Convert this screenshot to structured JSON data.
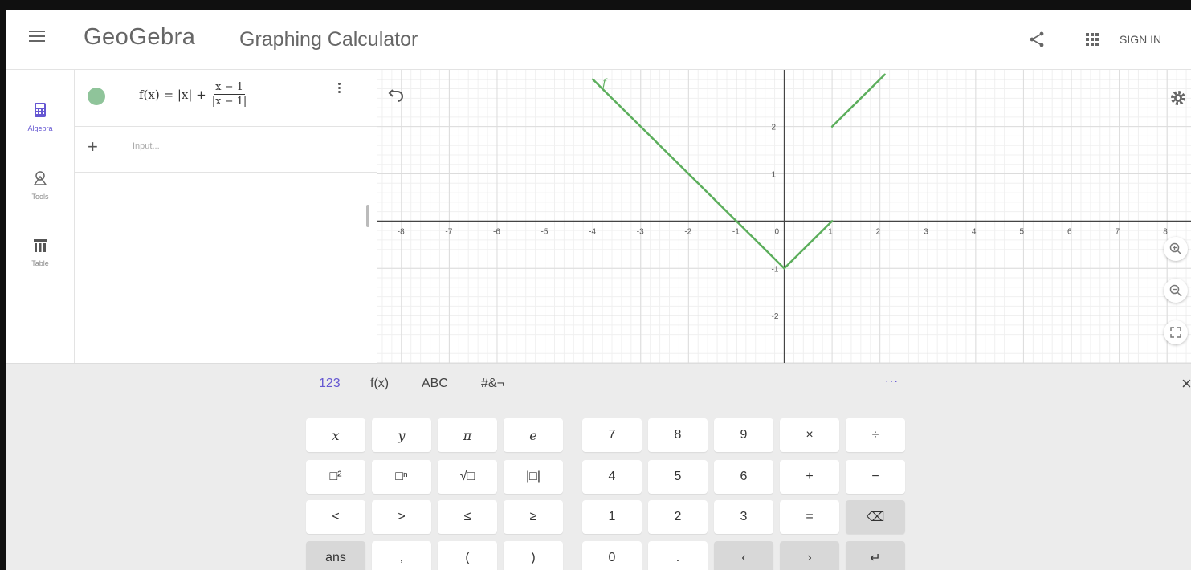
{
  "header": {
    "logo": "GeoGebra",
    "app_title": "Graphing Calculator",
    "sign_in": "SIGN IN"
  },
  "sidebar": {
    "items": [
      {
        "label": "Algebra",
        "icon": "calculator-icon",
        "active": true
      },
      {
        "label": "Tools",
        "icon": "shapes-icon",
        "active": false
      },
      {
        "label": "Table",
        "icon": "table-icon",
        "active": false
      }
    ]
  },
  "algebra": {
    "marble_color": "#8fc49a",
    "formula": {
      "lhs": "f(x) = |x| +",
      "num": "x − 1",
      "den": "|x − 1|"
    },
    "input_placeholder": "Input..."
  },
  "graph": {
    "function_label": "f",
    "function_color": "#5cae5c",
    "x_range": [
      -8.5,
      8.5
    ],
    "y_range": [
      -3,
      3.2
    ],
    "x_ticks": [
      "-8",
      "-7",
      "-6",
      "-5",
      "-4",
      "-3",
      "-2",
      "-1",
      "0",
      "1",
      "2",
      "3",
      "4",
      "5",
      "6",
      "7",
      "8"
    ],
    "y_ticks": [
      "2",
      "1",
      "-1",
      "-2"
    ],
    "segments": [
      {
        "from": [
          -4,
          3
        ],
        "to": [
          0,
          -1
        ]
      },
      {
        "from": [
          0,
          -1
        ],
        "to": [
          1,
          0
        ]
      },
      {
        "from": [
          1,
          2
        ],
        "to": [
          2.1,
          3.1
        ]
      }
    ]
  },
  "keyboard": {
    "tabs": [
      "123",
      "f(x)",
      "ABC",
      "#&¬"
    ],
    "active_tab": "123",
    "more": "···",
    "close": "×",
    "keys_left": [
      [
        "x",
        "y",
        "π",
        "e"
      ],
      [
        "□²",
        "□ⁿ",
        "√□",
        "|□|"
      ],
      [
        "<",
        ">",
        "≤",
        "≥"
      ],
      [
        "ans",
        ",",
        "(",
        ")"
      ]
    ],
    "keys_right": [
      [
        "7",
        "8",
        "9",
        "×",
        "÷"
      ],
      [
        "4",
        "5",
        "6",
        "+",
        "−"
      ],
      [
        "1",
        "2",
        "3",
        "=",
        "⌫"
      ],
      [
        "0",
        ".",
        "‹",
        "›",
        "↵"
      ]
    ]
  }
}
